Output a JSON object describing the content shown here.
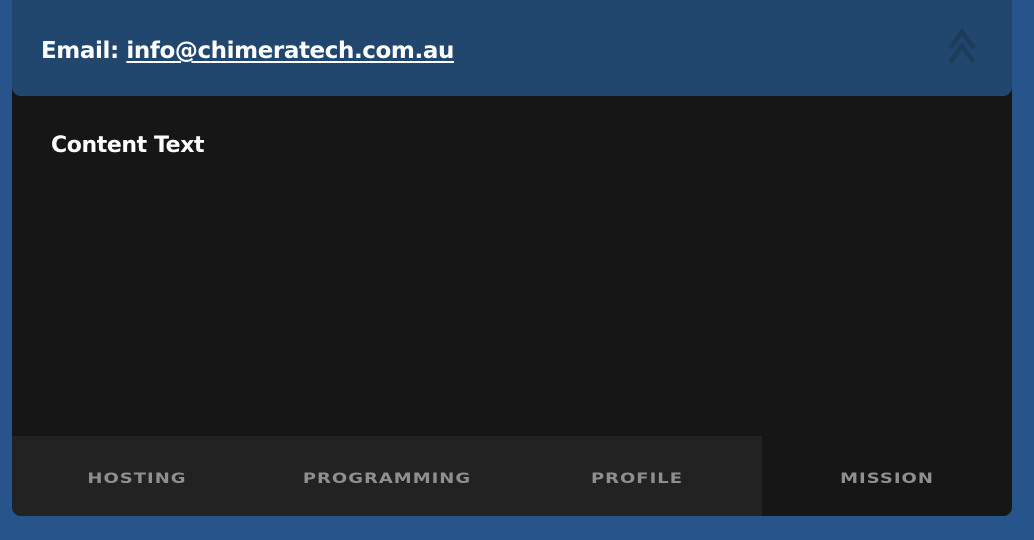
{
  "header": {
    "email_label": "Email:",
    "email_address": "info@chimeratech.com.au",
    "collapse_icon": "double-chevron-up-icon",
    "colors": {
      "header_bg": "#22476f",
      "icon": "#1d3c5c"
    }
  },
  "content": {
    "text": "Content Text"
  },
  "tabs": [
    {
      "label": "HOSTING",
      "active": false
    },
    {
      "label": "PROGRAMMING",
      "active": false
    },
    {
      "label": "PROFILE",
      "active": false
    },
    {
      "label": "MISSION",
      "active": true
    }
  ],
  "colors": {
    "page_bg": "#27548a",
    "panel_bg": "#161616",
    "tab_bg": "#222222",
    "tab_text": "#8f8f8f"
  }
}
